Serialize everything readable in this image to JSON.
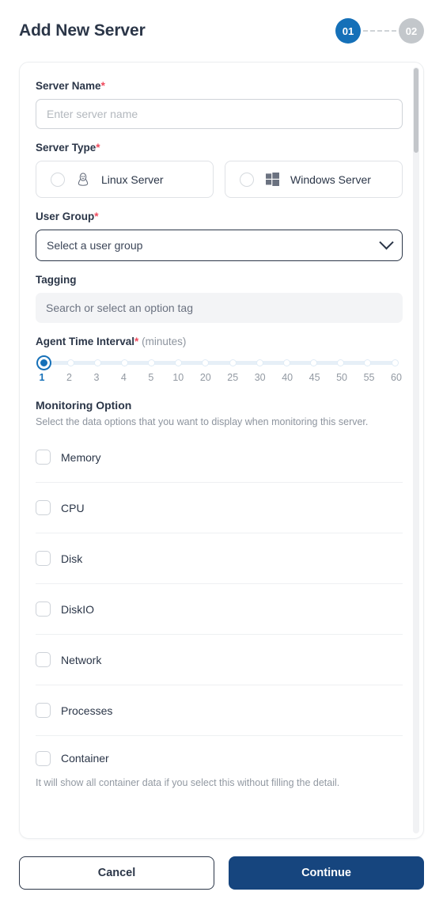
{
  "header": {
    "title": "Add New Server",
    "steps": [
      {
        "label": "01",
        "state": "active"
      },
      {
        "label": "02",
        "state": "inactive"
      }
    ]
  },
  "form": {
    "server_name": {
      "label": "Server Name",
      "required_mark": "*",
      "value": "",
      "placeholder": "Enter server name"
    },
    "server_type": {
      "label": "Server Type",
      "required_mark": "*",
      "options": [
        {
          "label": "Linux Server",
          "icon": "linux-penguin-icon",
          "selected": false
        },
        {
          "label": "Windows Server",
          "icon": "windows-logo-icon",
          "selected": false
        }
      ]
    },
    "user_group": {
      "label": "User Group",
      "required_mark": "*",
      "selected_value": "Select a user group"
    },
    "tagging": {
      "label": "Tagging",
      "value": "",
      "placeholder": "Search or select an option tag"
    },
    "agent_time_interval": {
      "label": "Agent Time Interval",
      "required_mark": "*",
      "unit": "(minutes)",
      "ticks": [
        "1",
        "2",
        "3",
        "4",
        "5",
        "10",
        "20",
        "25",
        "30",
        "40",
        "45",
        "50",
        "55",
        "60"
      ],
      "selected_index": 0,
      "selected_value": "1"
    },
    "monitoring_option": {
      "title": "Monitoring Option",
      "description": "Select the data options that you want to display when monitoring this server.",
      "items": [
        {
          "label": "Memory",
          "checked": false
        },
        {
          "label": "CPU",
          "checked": false
        },
        {
          "label": "Disk",
          "checked": false
        },
        {
          "label": "DiskIO",
          "checked": false
        },
        {
          "label": "Network",
          "checked": false
        },
        {
          "label": "Processes",
          "checked": false
        },
        {
          "label": "Container",
          "checked": false
        }
      ],
      "container_note": "It will show all container data if you select this without filling the detail."
    }
  },
  "footer": {
    "cancel_label": "Cancel",
    "continue_label": "Continue"
  },
  "colors": {
    "accent_blue": "#1570b8",
    "primary_navy": "#16457e",
    "required_red": "#ef4a5d",
    "text_dark": "#2b3648",
    "text_muted": "#8d949e",
    "step_inactive": "#c3c7cb"
  }
}
